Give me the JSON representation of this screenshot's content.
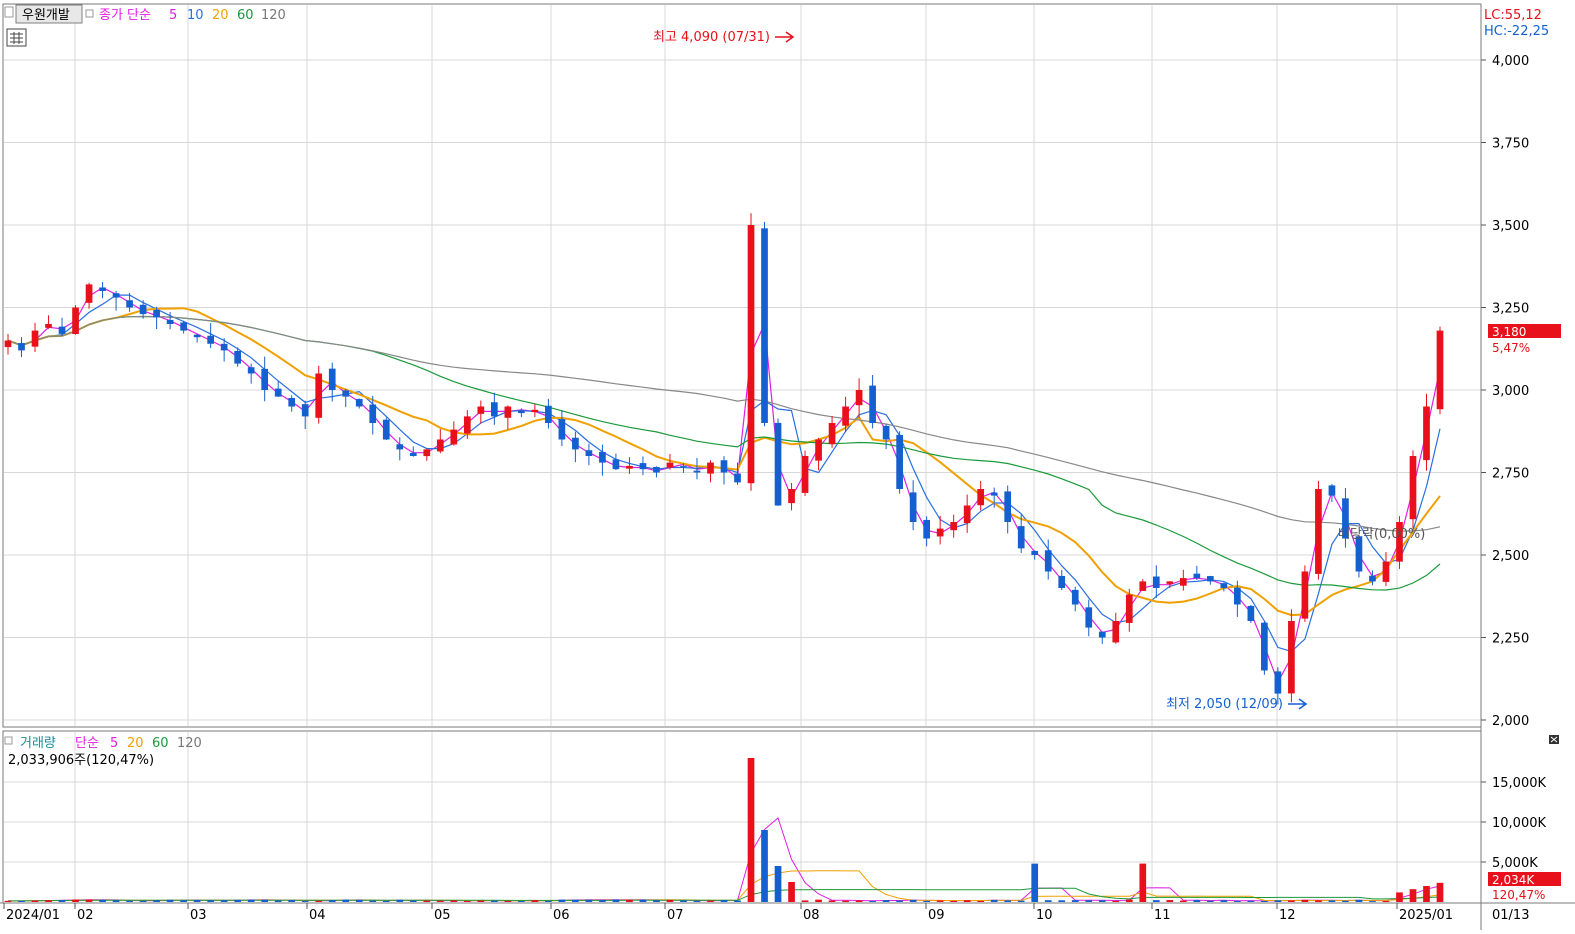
{
  "header": {
    "stock_name": "우원개발",
    "price_label": "종가 단순",
    "ma": [
      "5",
      "10",
      "20",
      "60",
      "120"
    ],
    "ma_colors": [
      "#e020e0",
      "#2a6fe0",
      "#f0a000",
      "#1a9a3a",
      "#888888"
    ],
    "lc": "LC:55,12",
    "hc": "HC:-22,25"
  },
  "volume_header": {
    "label": "거래량",
    "ma_label": "단순",
    "ma": [
      "5",
      "20",
      "60",
      "120"
    ],
    "value": "2,033,906주(120,47%)"
  },
  "annotations": {
    "high": "최고 4,090 (07/31)",
    "low": "최저 2,050 (12/09)",
    "dividend": "배당락(0,00%)"
  },
  "price_axis": {
    "ticks": [
      "4,000",
      "3,750",
      "3,500",
      "3,250",
      "3,000",
      "2,750",
      "2,500",
      "2,250",
      "2,000"
    ],
    "current_price": "3,180",
    "current_change": "5,47%"
  },
  "volume_axis": {
    "ticks": [
      "15,000K",
      "10,000K",
      "5,000K"
    ],
    "current_volume": "2,034K",
    "current_ratio": "120,47%"
  },
  "x_axis": {
    "ticks": [
      "2024/01",
      "02",
      "03",
      "04",
      "05",
      "06",
      "07",
      "08",
      "09",
      "10",
      "11",
      "12",
      "2025/01"
    ],
    "last_date": "01/13"
  },
  "colors": {
    "up": "#e8101a",
    "down": "#1560d0"
  },
  "chart_data": {
    "type": "candlestick",
    "x_range": [
      "2024-01",
      "2025-01-13"
    ],
    "ylim": [
      2000,
      4000
    ],
    "high": {
      "date": "07/31",
      "value": 4090
    },
    "low": {
      "date": "12/09",
      "value": 2050
    },
    "last_close": 3180,
    "last_change_pct": 5.47,
    "closes": [
      3150,
      3120,
      3180,
      3200,
      3170,
      3250,
      3320,
      3300,
      3280,
      3250,
      3230,
      3220,
      3200,
      3180,
      3160,
      3140,
      3120,
      3080,
      3050,
      3000,
      2980,
      2950,
      2920,
      3050,
      3000,
      2980,
      2950,
      2900,
      2850,
      2820,
      2800,
      2820,
      2850,
      2880,
      2920,
      2950,
      2920,
      2950,
      2930,
      2940,
      2900,
      2850,
      2820,
      2800,
      2780,
      2760,
      2770,
      2760,
      2750,
      2780,
      2770,
      2750,
      2780,
      2750,
      2720,
      3500,
      2900,
      2650,
      2700,
      2800,
      2850,
      2900,
      2950,
      3000,
      2900,
      2850,
      2700,
      2600,
      2550,
      2580,
      2600,
      2650,
      2700,
      2680,
      2600,
      2520,
      2500,
      2450,
      2400,
      2350,
      2280,
      2250,
      2300,
      2380,
      2420,
      2400,
      2420,
      2430,
      2430,
      2420,
      2400,
      2350,
      2300,
      2150,
      2080,
      2300,
      2450,
      2700,
      2680,
      2550,
      2450,
      2420,
      2480,
      2600,
      2800,
      2950,
      3180
    ]
  }
}
